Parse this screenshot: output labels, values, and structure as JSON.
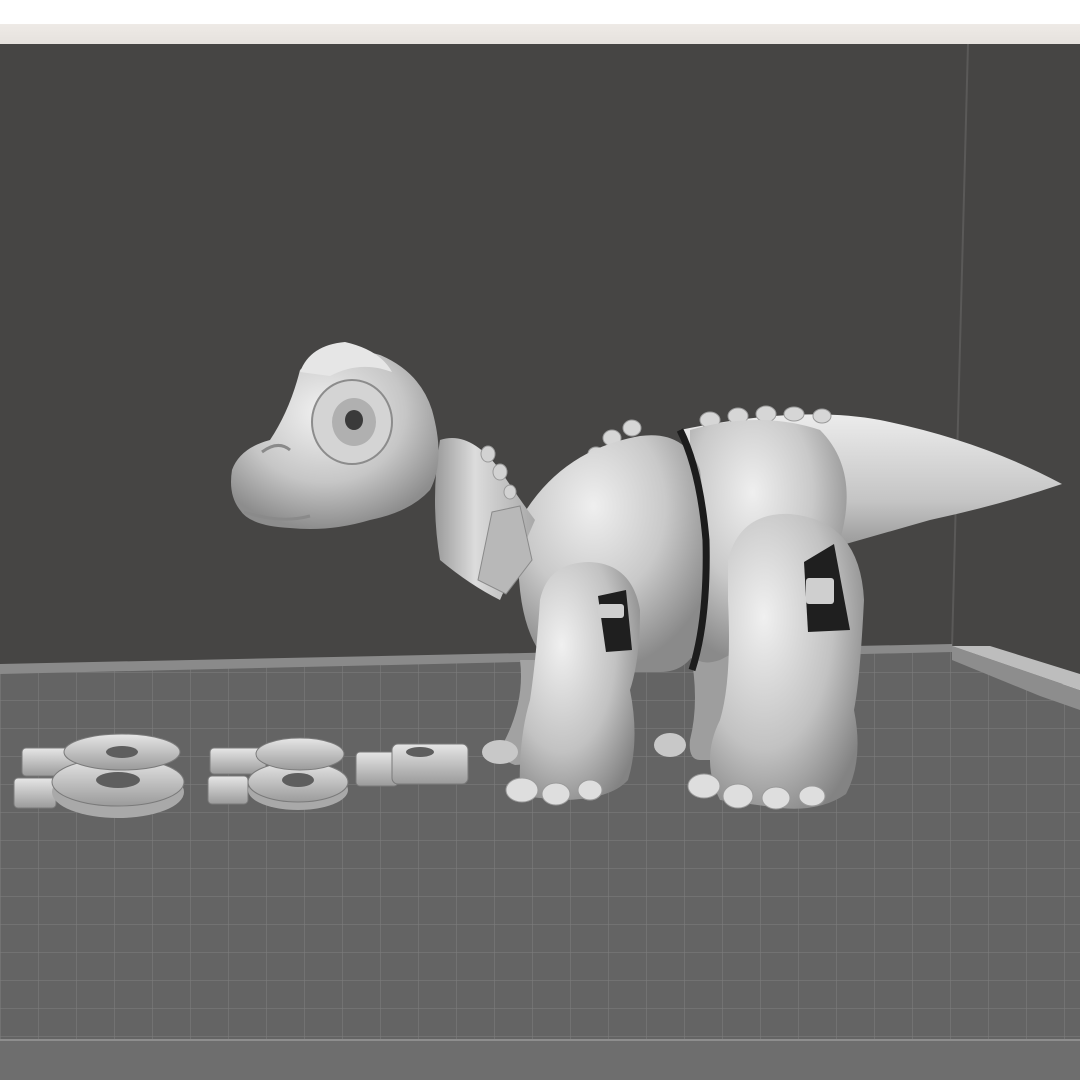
{
  "colors": {
    "background_wall": "#464544",
    "build_plate": "#636363",
    "grid_line": "#7a7a7a",
    "model": "#bdbdbd",
    "model_highlight": "#e8e8e8",
    "model_shadow": "#6f6f6f",
    "toolbar": "#e9e5e1"
  },
  "icons": {
    "model": "dinosaur-model",
    "parts": "joint-pin-parts"
  }
}
